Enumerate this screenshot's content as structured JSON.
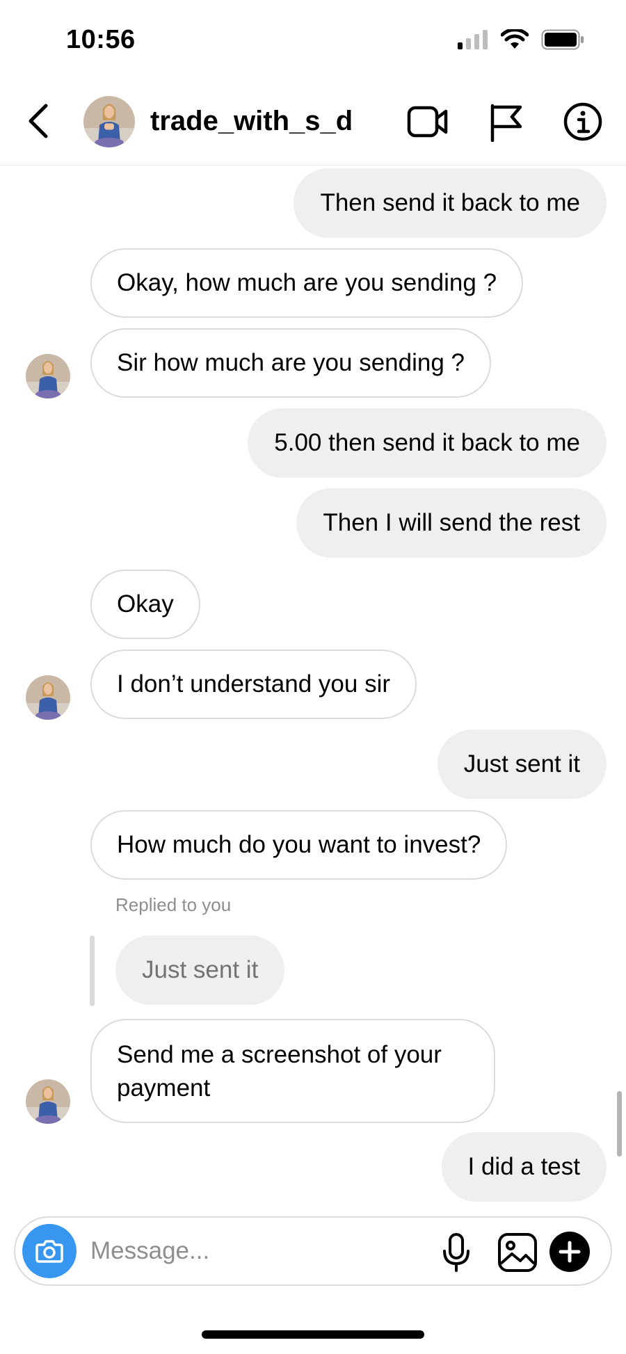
{
  "status_bar": {
    "time": "10:56"
  },
  "header": {
    "username": "trade_with_s_d"
  },
  "messages": {
    "m1": "Then send it back to me",
    "m2": "Okay, how much are you sending ?",
    "m3": "Sir how much are you sending ?",
    "m4": "5.00 then send it back to me",
    "m5": "Then I will send the rest",
    "m6": "Okay",
    "m7": "I don’t understand you sir",
    "m8": "Just sent it",
    "m9": "How much do you want to invest?",
    "reply_label": "Replied to you",
    "reply_quote": "Just sent it",
    "m10": "Send me a screenshot of your payment",
    "m11": "I did a test"
  },
  "composer": {
    "placeholder": "Message..."
  },
  "colors": {
    "accent": "#3797f0",
    "outgoing_bubble": "#efefef",
    "incoming_border": "#dbdbdb",
    "muted_text": "#8e8e8e"
  },
  "icons": [
    "chevron-left-icon",
    "video-camera-icon",
    "flag-icon",
    "info-icon",
    "camera-icon",
    "microphone-icon",
    "gallery-icon",
    "plus-icon",
    "signal-icon",
    "wifi-icon",
    "battery-icon"
  ]
}
